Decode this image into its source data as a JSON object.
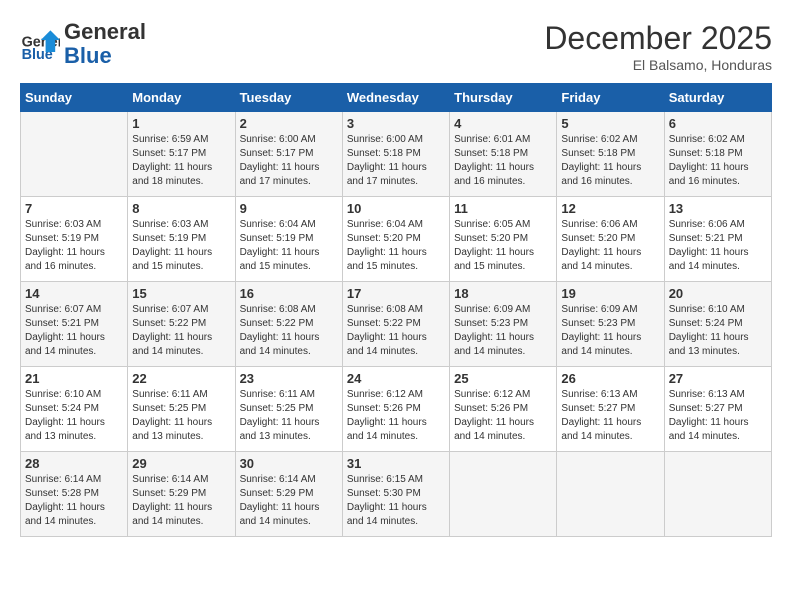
{
  "header": {
    "logo_line1": "General",
    "logo_line2": "Blue",
    "month": "December 2025",
    "location": "El Balsamo, Honduras"
  },
  "days_of_week": [
    "Sunday",
    "Monday",
    "Tuesday",
    "Wednesday",
    "Thursday",
    "Friday",
    "Saturday"
  ],
  "weeks": [
    [
      {
        "day": "",
        "sunrise": "",
        "sunset": "",
        "daylight": ""
      },
      {
        "day": "1",
        "sunrise": "6:59 AM",
        "sunset": "5:17 PM",
        "daylight": "11 hours and 18 minutes."
      },
      {
        "day": "2",
        "sunrise": "6:00 AM",
        "sunset": "5:17 PM",
        "daylight": "11 hours and 17 minutes."
      },
      {
        "day": "3",
        "sunrise": "6:00 AM",
        "sunset": "5:18 PM",
        "daylight": "11 hours and 17 minutes."
      },
      {
        "day": "4",
        "sunrise": "6:01 AM",
        "sunset": "5:18 PM",
        "daylight": "11 hours and 16 minutes."
      },
      {
        "day": "5",
        "sunrise": "6:02 AM",
        "sunset": "5:18 PM",
        "daylight": "11 hours and 16 minutes."
      },
      {
        "day": "6",
        "sunrise": "6:02 AM",
        "sunset": "5:18 PM",
        "daylight": "11 hours and 16 minutes."
      }
    ],
    [
      {
        "day": "7",
        "sunrise": "6:03 AM",
        "sunset": "5:19 PM",
        "daylight": "11 hours and 16 minutes."
      },
      {
        "day": "8",
        "sunrise": "6:03 AM",
        "sunset": "5:19 PM",
        "daylight": "11 hours and 15 minutes."
      },
      {
        "day": "9",
        "sunrise": "6:04 AM",
        "sunset": "5:19 PM",
        "daylight": "11 hours and 15 minutes."
      },
      {
        "day": "10",
        "sunrise": "6:04 AM",
        "sunset": "5:20 PM",
        "daylight": "11 hours and 15 minutes."
      },
      {
        "day": "11",
        "sunrise": "6:05 AM",
        "sunset": "5:20 PM",
        "daylight": "11 hours and 15 minutes."
      },
      {
        "day": "12",
        "sunrise": "6:06 AM",
        "sunset": "5:20 PM",
        "daylight": "11 hours and 14 minutes."
      },
      {
        "day": "13",
        "sunrise": "6:06 AM",
        "sunset": "5:21 PM",
        "daylight": "11 hours and 14 minutes."
      }
    ],
    [
      {
        "day": "14",
        "sunrise": "6:07 AM",
        "sunset": "5:21 PM",
        "daylight": "11 hours and 14 minutes."
      },
      {
        "day": "15",
        "sunrise": "6:07 AM",
        "sunset": "5:22 PM",
        "daylight": "11 hours and 14 minutes."
      },
      {
        "day": "16",
        "sunrise": "6:08 AM",
        "sunset": "5:22 PM",
        "daylight": "11 hours and 14 minutes."
      },
      {
        "day": "17",
        "sunrise": "6:08 AM",
        "sunset": "5:22 PM",
        "daylight": "11 hours and 14 minutes."
      },
      {
        "day": "18",
        "sunrise": "6:09 AM",
        "sunset": "5:23 PM",
        "daylight": "11 hours and 14 minutes."
      },
      {
        "day": "19",
        "sunrise": "6:09 AM",
        "sunset": "5:23 PM",
        "daylight": "11 hours and 14 minutes."
      },
      {
        "day": "20",
        "sunrise": "6:10 AM",
        "sunset": "5:24 PM",
        "daylight": "11 hours and 13 minutes."
      }
    ],
    [
      {
        "day": "21",
        "sunrise": "6:10 AM",
        "sunset": "5:24 PM",
        "daylight": "11 hours and 13 minutes."
      },
      {
        "day": "22",
        "sunrise": "6:11 AM",
        "sunset": "5:25 PM",
        "daylight": "11 hours and 13 minutes."
      },
      {
        "day": "23",
        "sunrise": "6:11 AM",
        "sunset": "5:25 PM",
        "daylight": "11 hours and 13 minutes."
      },
      {
        "day": "24",
        "sunrise": "6:12 AM",
        "sunset": "5:26 PM",
        "daylight": "11 hours and 14 minutes."
      },
      {
        "day": "25",
        "sunrise": "6:12 AM",
        "sunset": "5:26 PM",
        "daylight": "11 hours and 14 minutes."
      },
      {
        "day": "26",
        "sunrise": "6:13 AM",
        "sunset": "5:27 PM",
        "daylight": "11 hours and 14 minutes."
      },
      {
        "day": "27",
        "sunrise": "6:13 AM",
        "sunset": "5:27 PM",
        "daylight": "11 hours and 14 minutes."
      }
    ],
    [
      {
        "day": "28",
        "sunrise": "6:14 AM",
        "sunset": "5:28 PM",
        "daylight": "11 hours and 14 minutes."
      },
      {
        "day": "29",
        "sunrise": "6:14 AM",
        "sunset": "5:29 PM",
        "daylight": "11 hours and 14 minutes."
      },
      {
        "day": "30",
        "sunrise": "6:14 AM",
        "sunset": "5:29 PM",
        "daylight": "11 hours and 14 minutes."
      },
      {
        "day": "31",
        "sunrise": "6:15 AM",
        "sunset": "5:30 PM",
        "daylight": "11 hours and 14 minutes."
      },
      {
        "day": "",
        "sunrise": "",
        "sunset": "",
        "daylight": ""
      },
      {
        "day": "",
        "sunrise": "",
        "sunset": "",
        "daylight": ""
      },
      {
        "day": "",
        "sunrise": "",
        "sunset": "",
        "daylight": ""
      }
    ]
  ],
  "labels": {
    "sunrise": "Sunrise:",
    "sunset": "Sunset:",
    "daylight": "Daylight:"
  }
}
